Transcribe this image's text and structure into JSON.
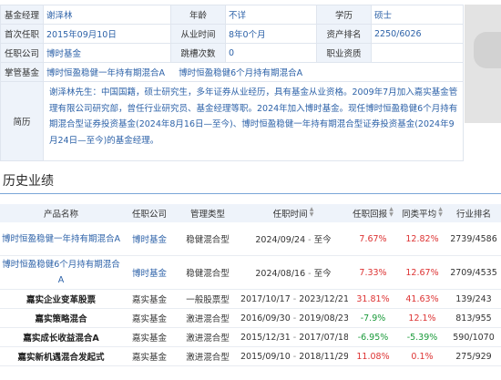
{
  "manager": {
    "name_label": "基金经理",
    "name": "谢泽林",
    "age_label": "年龄",
    "age": "不详",
    "edu_label": "学历",
    "edu": "硕士",
    "first_term_label": "首次任职",
    "first_term": "2015年09月10日",
    "exp_label": "从业时间",
    "exp": "8年0个月",
    "asset_label": "资产排名",
    "asset_rank": "2250/6026",
    "company_label": "任职公司",
    "company": "博时基金",
    "swing_label": "跳槽次数",
    "swing": "0",
    "cert_label": "职业资质",
    "cert": "",
    "funds_label": "掌管基金",
    "funds": [
      "博时恒盈稳健一年持有期混合A",
      "博时恒盈稳健6个月持有期混合A"
    ],
    "bio_label": "简历",
    "bio": "谢泽林先生：中国国籍，硕士研究生，多年证券从业经历，具有基金从业资格。2009年7月加入嘉实基金管理有限公司研究部，曾任行业研究员、基金经理等职。2024年加入博时基金。现任博时恒盈稳健6个月持有期混合型证券投资基金(2024年8月16日—至今)、博时恒盈稳健一年持有期混合型证券投资基金(2024年9月24日—至今)的基金经理。"
  },
  "section_title": "历史业绩",
  "history": {
    "headers": [
      "产品名称",
      "任职公司",
      "管理类型",
      "任职时间",
      "任职回报",
      "同类平均",
      "行业排名"
    ],
    "sort_icon": "sort-icon",
    "rows": [
      {
        "fund": "博时恒盈稳健一年持有期混合A",
        "company": "博时基金",
        "type": "稳健混合型",
        "start": "2024/09/24",
        "end": "至今",
        "ret": "7.67%",
        "avg": "12.82%",
        "rank": "2739/4586"
      },
      {
        "fund": "博时恒盈稳健6个月持有期混合A",
        "company": "博时基金",
        "type": "稳健混合型",
        "start": "2024/08/16",
        "end": "至今",
        "ret": "7.33%",
        "avg": "12.67%",
        "rank": "2709/4535"
      },
      {
        "fund": "嘉实企业变革股票",
        "company": "嘉实基金",
        "type": "一般股票型",
        "start": "2017/10/17",
        "end": "2023/12/21",
        "ret": "31.81%",
        "avg": "41.63%",
        "rank": "139/243"
      },
      {
        "fund": "嘉实策略混合",
        "company": "嘉实基金",
        "type": "激进混合型",
        "start": "2016/09/30",
        "end": "2019/08/23",
        "ret": "-7.9%",
        "avg": "12.1%",
        "rank": "813/955"
      },
      {
        "fund": "嘉实成长收益混合A",
        "company": "嘉实基金",
        "type": "激进混合型",
        "start": "2015/12/31",
        "end": "2017/07/18",
        "ret": "-6.95%",
        "avg": "-5.39%",
        "rank": "590/1070"
      },
      {
        "fund": "嘉实新机遇混合发起式",
        "company": "嘉实基金",
        "type": "激进混合型",
        "start": "2015/09/10",
        "end": "2018/11/29",
        "ret": "11.08%",
        "avg": "0.1%",
        "rank": "275/929"
      }
    ]
  },
  "colors": {
    "accent": "#2d62a8",
    "header_bg": "#eef3fa",
    "border": "#dfe5ee",
    "up": "#d33",
    "down": "#1a9a3a"
  }
}
